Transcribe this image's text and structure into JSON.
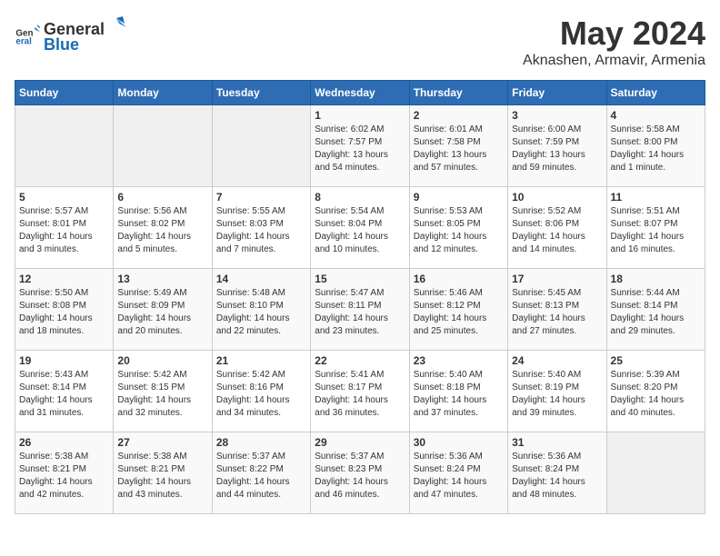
{
  "header": {
    "logo_general": "General",
    "logo_blue": "Blue",
    "month": "May 2024",
    "location": "Aknashen, Armavir, Armenia"
  },
  "weekdays": [
    "Sunday",
    "Monday",
    "Tuesday",
    "Wednesday",
    "Thursday",
    "Friday",
    "Saturday"
  ],
  "weeks": [
    [
      {
        "day": "",
        "empty": true
      },
      {
        "day": "",
        "empty": true
      },
      {
        "day": "",
        "empty": true
      },
      {
        "day": "1",
        "sunrise": "6:02 AM",
        "sunset": "7:57 PM",
        "daylight": "13 hours and 54 minutes."
      },
      {
        "day": "2",
        "sunrise": "6:01 AM",
        "sunset": "7:58 PM",
        "daylight": "13 hours and 57 minutes."
      },
      {
        "day": "3",
        "sunrise": "6:00 AM",
        "sunset": "7:59 PM",
        "daylight": "13 hours and 59 minutes."
      },
      {
        "day": "4",
        "sunrise": "5:58 AM",
        "sunset": "8:00 PM",
        "daylight": "14 hours and 1 minute."
      }
    ],
    [
      {
        "day": "5",
        "sunrise": "5:57 AM",
        "sunset": "8:01 PM",
        "daylight": "14 hours and 3 minutes."
      },
      {
        "day": "6",
        "sunrise": "5:56 AM",
        "sunset": "8:02 PM",
        "daylight": "14 hours and 5 minutes."
      },
      {
        "day": "7",
        "sunrise": "5:55 AM",
        "sunset": "8:03 PM",
        "daylight": "14 hours and 7 minutes."
      },
      {
        "day": "8",
        "sunrise": "5:54 AM",
        "sunset": "8:04 PM",
        "daylight": "14 hours and 10 minutes."
      },
      {
        "day": "9",
        "sunrise": "5:53 AM",
        "sunset": "8:05 PM",
        "daylight": "14 hours and 12 minutes."
      },
      {
        "day": "10",
        "sunrise": "5:52 AM",
        "sunset": "8:06 PM",
        "daylight": "14 hours and 14 minutes."
      },
      {
        "day": "11",
        "sunrise": "5:51 AM",
        "sunset": "8:07 PM",
        "daylight": "14 hours and 16 minutes."
      }
    ],
    [
      {
        "day": "12",
        "sunrise": "5:50 AM",
        "sunset": "8:08 PM",
        "daylight": "14 hours and 18 minutes."
      },
      {
        "day": "13",
        "sunrise": "5:49 AM",
        "sunset": "8:09 PM",
        "daylight": "14 hours and 20 minutes."
      },
      {
        "day": "14",
        "sunrise": "5:48 AM",
        "sunset": "8:10 PM",
        "daylight": "14 hours and 22 minutes."
      },
      {
        "day": "15",
        "sunrise": "5:47 AM",
        "sunset": "8:11 PM",
        "daylight": "14 hours and 23 minutes."
      },
      {
        "day": "16",
        "sunrise": "5:46 AM",
        "sunset": "8:12 PM",
        "daylight": "14 hours and 25 minutes."
      },
      {
        "day": "17",
        "sunrise": "5:45 AM",
        "sunset": "8:13 PM",
        "daylight": "14 hours and 27 minutes."
      },
      {
        "day": "18",
        "sunrise": "5:44 AM",
        "sunset": "8:14 PM",
        "daylight": "14 hours and 29 minutes."
      }
    ],
    [
      {
        "day": "19",
        "sunrise": "5:43 AM",
        "sunset": "8:14 PM",
        "daylight": "14 hours and 31 minutes."
      },
      {
        "day": "20",
        "sunrise": "5:42 AM",
        "sunset": "8:15 PM",
        "daylight": "14 hours and 32 minutes."
      },
      {
        "day": "21",
        "sunrise": "5:42 AM",
        "sunset": "8:16 PM",
        "daylight": "14 hours and 34 minutes."
      },
      {
        "day": "22",
        "sunrise": "5:41 AM",
        "sunset": "8:17 PM",
        "daylight": "14 hours and 36 minutes."
      },
      {
        "day": "23",
        "sunrise": "5:40 AM",
        "sunset": "8:18 PM",
        "daylight": "14 hours and 37 minutes."
      },
      {
        "day": "24",
        "sunrise": "5:40 AM",
        "sunset": "8:19 PM",
        "daylight": "14 hours and 39 minutes."
      },
      {
        "day": "25",
        "sunrise": "5:39 AM",
        "sunset": "8:20 PM",
        "daylight": "14 hours and 40 minutes."
      }
    ],
    [
      {
        "day": "26",
        "sunrise": "5:38 AM",
        "sunset": "8:21 PM",
        "daylight": "14 hours and 42 minutes."
      },
      {
        "day": "27",
        "sunrise": "5:38 AM",
        "sunset": "8:21 PM",
        "daylight": "14 hours and 43 minutes."
      },
      {
        "day": "28",
        "sunrise": "5:37 AM",
        "sunset": "8:22 PM",
        "daylight": "14 hours and 44 minutes."
      },
      {
        "day": "29",
        "sunrise": "5:37 AM",
        "sunset": "8:23 PM",
        "daylight": "14 hours and 46 minutes."
      },
      {
        "day": "30",
        "sunrise": "5:36 AM",
        "sunset": "8:24 PM",
        "daylight": "14 hours and 47 minutes."
      },
      {
        "day": "31",
        "sunrise": "5:36 AM",
        "sunset": "8:24 PM",
        "daylight": "14 hours and 48 minutes."
      },
      {
        "day": "",
        "empty": true
      }
    ]
  ],
  "labels": {
    "sunrise": "Sunrise:",
    "sunset": "Sunset:",
    "daylight": "Daylight:"
  }
}
